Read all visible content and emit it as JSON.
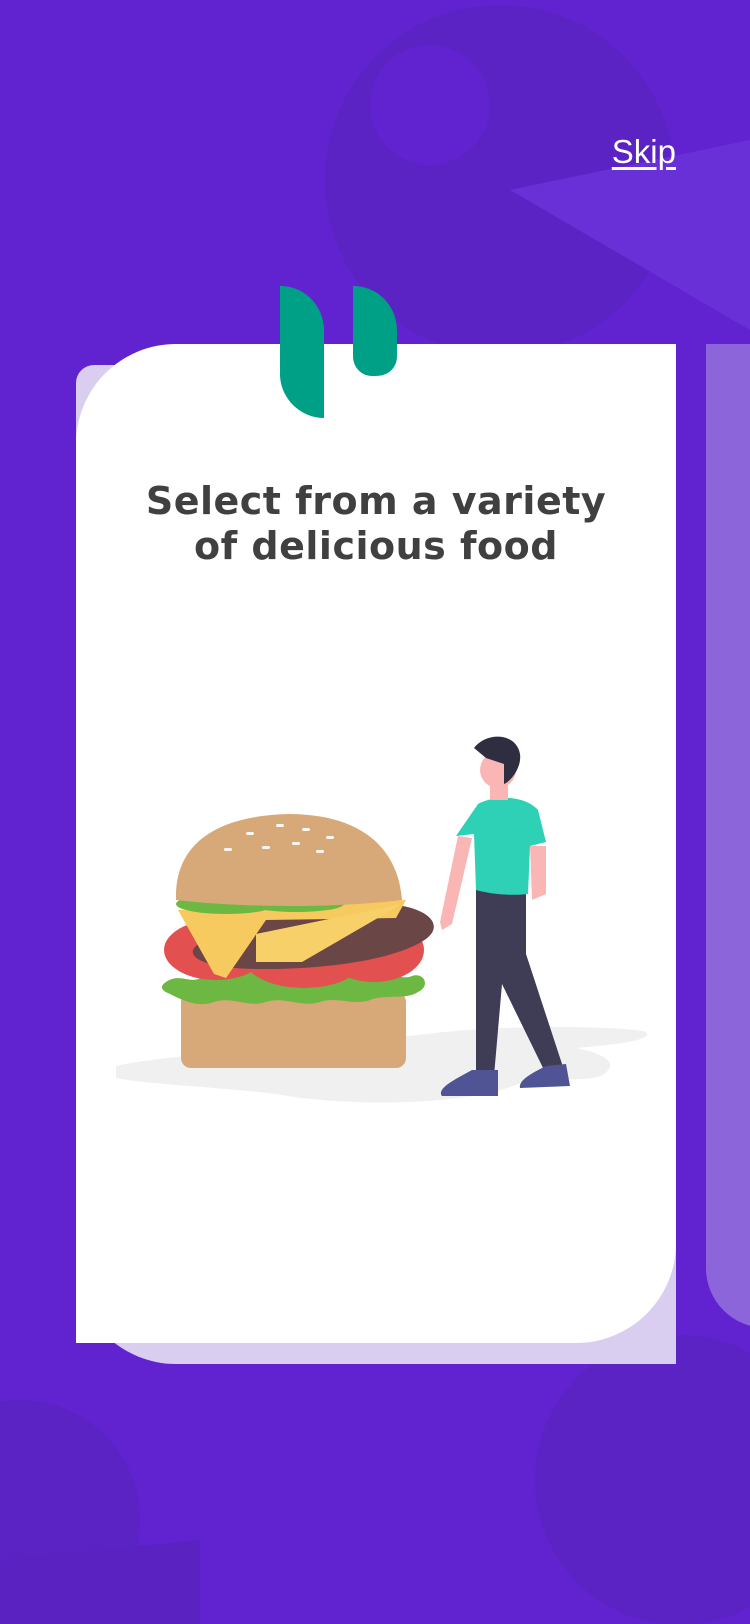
{
  "header": {
    "skip_label": "Skip"
  },
  "onboarding": {
    "title_line1": "Select from a variety",
    "title_line2": "of delicious food"
  },
  "colors": {
    "background": "#6123cf",
    "card": "#ffffff",
    "accent": "#00a087",
    "title_text": "#404040"
  },
  "icons": {
    "quote": "quote-mark-icon",
    "illustration": "burger-person-illustration"
  }
}
